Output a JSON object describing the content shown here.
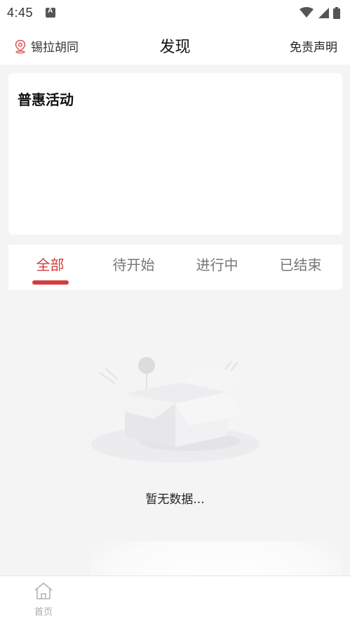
{
  "status_bar": {
    "time": "4:45",
    "icons": [
      "app-notification-icon",
      "wifi-icon",
      "signal-icon",
      "battery-icon"
    ]
  },
  "header": {
    "location": "锡拉胡同",
    "title": "发现",
    "disclaimer": "免责声明"
  },
  "promo": {
    "title": "普惠活动"
  },
  "tabs": [
    {
      "label": "全部",
      "active": true
    },
    {
      "label": "待开始",
      "active": false
    },
    {
      "label": "进行中",
      "active": false
    },
    {
      "label": "已结束",
      "active": false
    }
  ],
  "empty_state": {
    "message": "暂无数据..."
  },
  "bottom_nav": {
    "items": [
      {
        "label": "首页",
        "icon": "home-icon"
      }
    ]
  },
  "colors": {
    "accent": "#d23c3c",
    "background": "#f4f4f5",
    "surface": "#ffffff"
  }
}
